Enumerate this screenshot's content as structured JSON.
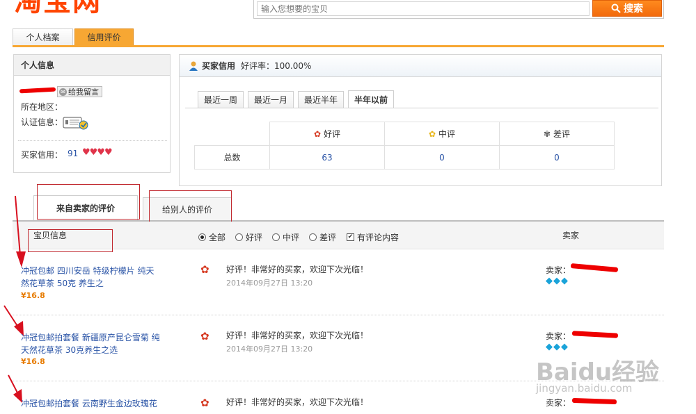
{
  "header": {
    "logo_text": "淘宝网",
    "search_placeholder": "输入您想要的宝贝",
    "search_button": "搜索"
  },
  "top_tabs": [
    {
      "label": "个人档案"
    },
    {
      "label": "信用评价"
    }
  ],
  "personal_info": {
    "title": "个人信息",
    "leave_message": "给我留言",
    "region_label": "所在地区：",
    "cert_label": "认证信息：",
    "buyer_credit_label": "买家信用：",
    "buyer_credit_value": "91"
  },
  "credit": {
    "title": "买家信用",
    "rate_label": "好评率：",
    "rate_value": "100.00%",
    "tabs": [
      {
        "label": "最近一周"
      },
      {
        "label": "最近一月"
      },
      {
        "label": "最近半年"
      },
      {
        "label": "半年以前"
      }
    ],
    "columns": [
      "好评",
      "中评",
      "差评"
    ],
    "row_label": "总数",
    "values": [
      "63",
      "0",
      "0"
    ]
  },
  "review_tabs": [
    {
      "label": "来自卖家的评价"
    },
    {
      "label": "给别人的评价"
    }
  ],
  "filter": {
    "item_info_header": "宝贝信息",
    "seller_header": "卖家",
    "options": [
      {
        "label": "全部",
        "selected": true
      },
      {
        "label": "好评",
        "selected": false
      },
      {
        "label": "中评",
        "selected": false
      },
      {
        "label": "差评",
        "selected": false
      }
    ],
    "has_comment_label": "有评论内容",
    "has_comment_checked": true
  },
  "reviews": [
    {
      "title_line1": "冲冠包邮 四川安岳 特级柠檬片 纯天",
      "title_line2": "然花草茶 50克 养生之",
      "price": "¥16.8",
      "comment": "好评！非常好的买家，欢迎下次光临！",
      "date": "2014年09月27日 13:20",
      "seller_label": "卖家："
    },
    {
      "title_line1": "冲冠包邮拍套餐 新疆原产昆仑雪菊 纯",
      "title_line2": "天然花草茶 30克养生之选",
      "price": "¥16.8",
      "comment": "好评！非常好的买家，欢迎下次光临！",
      "date": "2014年09月27日 13:20",
      "seller_label": "卖家："
    },
    {
      "title_line1": "冲冠包邮拍套餐 云南野生金边玫瑰花",
      "title_line2": "",
      "price": "",
      "comment": "好评！非常好的买家，欢迎下次光临！",
      "date": "",
      "seller_label": "卖家："
    }
  ],
  "watermark": {
    "main": "Baidu经验",
    "sub": "jingyan.baidu.com"
  },
  "colors": {
    "accent": "#f7a733",
    "brand": "#ff4400",
    "link": "#2953a6",
    "price": "#e77b00",
    "annotation": "#c0272d"
  }
}
